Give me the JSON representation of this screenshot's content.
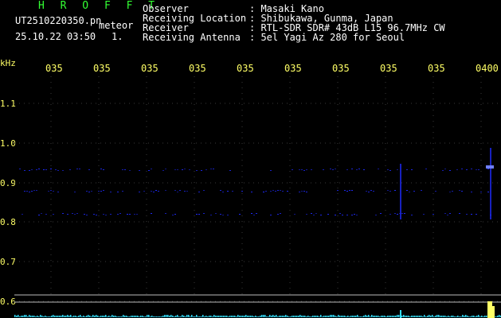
{
  "header": {
    "brand": "H R O F F T",
    "filename": "UT2510220350.pn",
    "mode": "meteor",
    "datetime": "25.10.22 03:50",
    "count": "1.",
    "fields": [
      {
        "label": "Observer",
        "value": ": Masaki Kano"
      },
      {
        "label": "Receiving Location",
        "value": ": Shibukawa, Gunma, Japan"
      },
      {
        "label": "Receiver",
        "value": ": RTL-SDR SDR# 43dB L15 96.7MHz CW"
      },
      {
        "label": "Receiving Antenna",
        "value": ": 5el Yagi Az 280 for Seoul"
      }
    ]
  },
  "axis": {
    "unit": "kHz",
    "y_ticks": [
      "1.1",
      "1.0",
      "0.9",
      "0.8",
      "0.7",
      "0.6"
    ],
    "x_ticks": [
      "035",
      "035",
      "035",
      "035",
      "035",
      "035",
      "035",
      "035",
      "035",
      "0400"
    ]
  },
  "colors": {
    "background": "#000000",
    "grid": "#3a3a3a",
    "yellow": "#ffff66",
    "green": "#33ff33",
    "trace": "#1f2bff",
    "cyan": "#33ddff"
  }
}
